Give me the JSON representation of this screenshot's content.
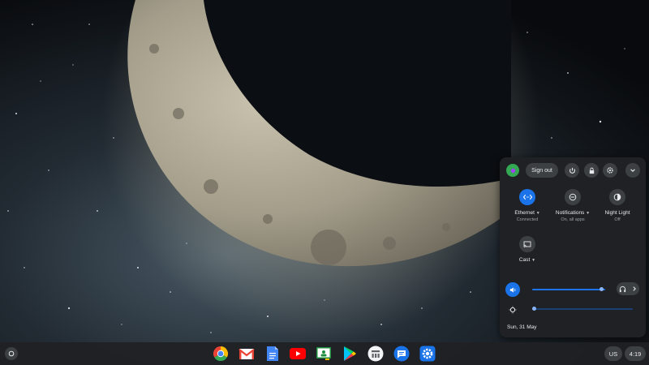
{
  "quick_settings": {
    "sign_out_label": "Sign out",
    "features": [
      {
        "name": "Ethernet",
        "status": "Connected",
        "icon": "ethernet-icon",
        "active": true
      },
      {
        "name": "Notifications",
        "status": "On, all apps",
        "icon": "do-not-disturb-icon",
        "active": false
      },
      {
        "name": "Night Light",
        "status": "Off",
        "icon": "night-light-icon",
        "active": false
      },
      {
        "name": "Cast",
        "status": "",
        "icon": "cast-icon",
        "active": false
      }
    ],
    "volume_level": 0.95,
    "brightness_level": 0.02,
    "date": "Sun, 31 May"
  },
  "shelf": {
    "apps": [
      "Chrome",
      "Gmail",
      "Docs",
      "YouTube",
      "Classroom",
      "Play Store",
      "Calculator",
      "Messages",
      "Settings"
    ],
    "ime_label": "US",
    "time": "4:19"
  },
  "colors": {
    "accent": "#1a73e8",
    "accent_light": "#8ab4f8",
    "panel_bg": "#202124",
    "chip_bg": "#3c4043"
  }
}
